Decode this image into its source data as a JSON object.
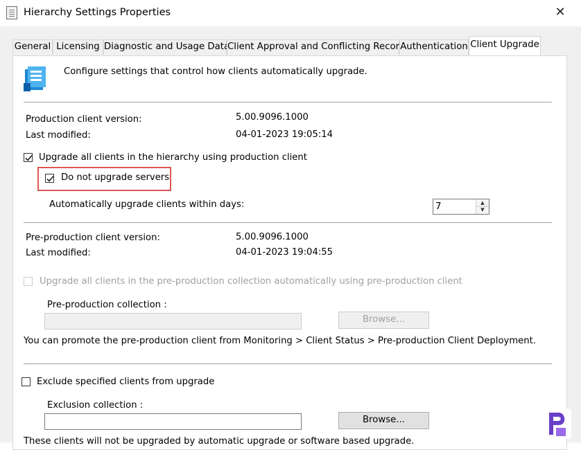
{
  "window": {
    "title": "Hierarchy Settings Properties",
    "close_glyph": "✕"
  },
  "tabs": [
    {
      "label": "General"
    },
    {
      "label": "Licensing"
    },
    {
      "label": "Diagnostic and Usage Data"
    },
    {
      "label": "Client Approval and Conflicting Records"
    },
    {
      "label": "Authentication"
    },
    {
      "label": "Client Upgrade",
      "active": true
    }
  ],
  "intro": {
    "text": "Configure settings that control how clients automatically upgrade.",
    "icon": "client-upgrade-icon"
  },
  "production": {
    "version_label": "Production client version:",
    "version_value": "5.00.9096.1000",
    "modified_label": "Last modified:",
    "modified_value": "04-01-2023 19:05:14",
    "upgrade_all_label": "Upgrade all clients in the hierarchy using production client",
    "upgrade_all_checked": true,
    "no_servers_label": "Do not upgrade servers",
    "no_servers_checked": true,
    "days_label": "Automatically upgrade clients within days:",
    "days_value": "7"
  },
  "preproduction": {
    "version_label": "Pre-production client version:",
    "version_value": "5.00.9096.1000",
    "modified_label": "Last modified:",
    "modified_value": "04-01-2023 19:04:55",
    "upgrade_label": "Upgrade all clients in the pre-production collection automatically using pre-production client",
    "upgrade_checked": false,
    "collection_label": "Pre-production collection :",
    "collection_value": "",
    "browse_label": "Browse...",
    "promote_text": "You can promote the pre-production client from Monitoring > Client Status > Pre-production Client Deployment."
  },
  "exclusion": {
    "exclude_label": "Exclude specified clients from upgrade",
    "exclude_checked": false,
    "collection_label": "Exclusion collection :",
    "collection_value": "",
    "browse_label": "Browse...",
    "footer_text": "These clients will not be upgraded by automatic upgrade or software based upgrade."
  },
  "colors": {
    "highlight": "#e05555",
    "tab_bg": "#f0f0f0",
    "brand": "#6a3fc7"
  }
}
